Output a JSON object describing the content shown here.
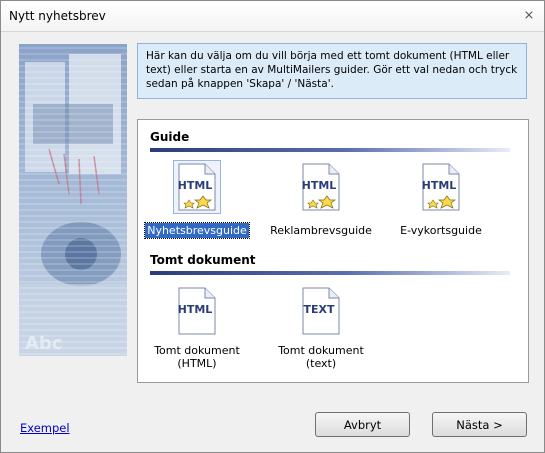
{
  "window": {
    "title": "Nytt nyhetsbrev",
    "close_glyph": "⨯"
  },
  "side_image": {
    "caption": "Abc"
  },
  "info": {
    "text": "Här kan du välja om du vill börja med ett tomt dokument (HTML eller text) eller starta en av MultiMailers guider. Gör ett val nedan och tryck sedan på knappen 'Skapa' / 'Nästa'."
  },
  "sections": {
    "guide": {
      "title": "Guide",
      "items": [
        {
          "label": "Nyhetsbrevsguide",
          "icon_text": "HTML",
          "selected": true
        },
        {
          "label": "Reklambrevsguide",
          "icon_text": "HTML",
          "selected": false
        },
        {
          "label": "E-vykortsguide",
          "icon_text": "HTML",
          "selected": false
        }
      ]
    },
    "empty": {
      "title": "Tomt dokument",
      "items": [
        {
          "label_line1": "Tomt dokument",
          "label_line2": "(HTML)",
          "icon_text": "HTML"
        },
        {
          "label_line1": "Tomt dokument",
          "label_line2": "(text)",
          "icon_text": "TEXT"
        }
      ]
    }
  },
  "footer": {
    "example_link": "Exempel",
    "cancel_label": "Avbryt",
    "next_label": "Nästa >"
  },
  "colors": {
    "accent": "#316ac5",
    "info_bg": "#dcebf8",
    "rule": "#2b3c7a"
  }
}
